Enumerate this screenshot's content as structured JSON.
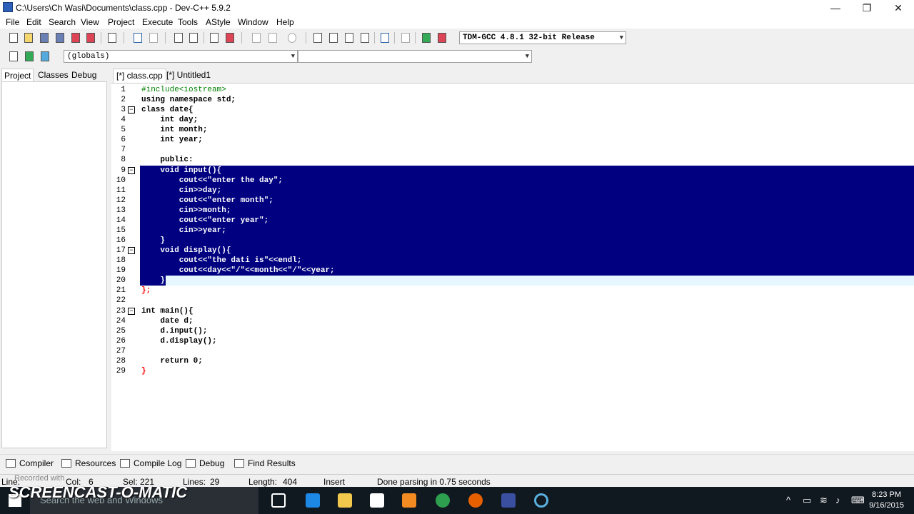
{
  "window": {
    "title": "C:\\Users\\Ch Wasi\\Documents\\class.cpp - Dev-C++ 5.9.2",
    "minimize": "—",
    "maximize": "❐",
    "close": "✕"
  },
  "menu": [
    "File",
    "Edit",
    "Search",
    "View",
    "Project",
    "Execute",
    "Tools",
    "AStyle",
    "Window",
    "Help"
  ],
  "toolbar": {
    "compiler_select": "TDM-GCC 4.8.1 32-bit Release",
    "scope_select": "(globals)",
    "member_select": ""
  },
  "left_panel": {
    "tabs": [
      "Project",
      "Classes",
      "Debug"
    ]
  },
  "file_tabs": [
    "[*] class.cpp",
    "[*] Untitled1"
  ],
  "editor": {
    "lines": [
      {
        "n": "1",
        "text": "#include<iostream>"
      },
      {
        "n": "2",
        "text": "using namespace std;"
      },
      {
        "n": "3",
        "text": "class date{"
      },
      {
        "n": "4",
        "text": "    int day;"
      },
      {
        "n": "5",
        "text": "    int month;"
      },
      {
        "n": "6",
        "text": "    int year;"
      },
      {
        "n": "7",
        "text": ""
      },
      {
        "n": "8",
        "text": "    public:"
      },
      {
        "n": "9",
        "text": "    void input(){"
      },
      {
        "n": "10",
        "text": "        cout<<\"enter the day\";"
      },
      {
        "n": "11",
        "text": "        cin>>day;"
      },
      {
        "n": "12",
        "text": "        cout<<\"enter month\";"
      },
      {
        "n": "13",
        "text": "        cin>>month;"
      },
      {
        "n": "14",
        "text": "        cout<<\"enter year\";"
      },
      {
        "n": "15",
        "text": "        cin>>year;"
      },
      {
        "n": "16",
        "text": "    }"
      },
      {
        "n": "17",
        "text": "    void display(){"
      },
      {
        "n": "18",
        "text": "        cout<<\"the dati is\"<<endl;"
      },
      {
        "n": "19",
        "text": "        cout<<day<<\"/\"<<month<<\"/\"<<year;"
      },
      {
        "n": "20",
        "text": "    }"
      },
      {
        "n": "21",
        "text": "};"
      },
      {
        "n": "22",
        "text": ""
      },
      {
        "n": "23",
        "text": "int main(){"
      },
      {
        "n": "24",
        "text": "    date d;"
      },
      {
        "n": "25",
        "text": "    d.input();"
      },
      {
        "n": "26",
        "text": "    d.display();"
      },
      {
        "n": "27",
        "text": ""
      },
      {
        "n": "28",
        "text": "    return 0;"
      },
      {
        "n": "29",
        "text": "}"
      }
    ]
  },
  "bottom_tabs": [
    "Compiler",
    "Resources",
    "Compile Log",
    "Debug",
    "Find Results"
  ],
  "status": {
    "line_label": "Line:",
    "col_label": "Col:",
    "col_value": "6",
    "sel_label": "Sel:",
    "sel_value": "221",
    "lines_label": "Lines:",
    "lines_value": "29",
    "length_label": "Length:",
    "length_value": "404",
    "mode": "Insert",
    "message": "Done parsing in 0.75 seconds"
  },
  "taskbar": {
    "search_placeholder": "Search the web and Windows",
    "time": "8:23 PM",
    "date": "9/16/2015"
  },
  "watermark": {
    "recorded": "Recorded with",
    "brand": "SCREENCAST-O-MATIC"
  },
  "colors": {
    "selection": "#000080",
    "keyword_text": "#000000",
    "brace": "#ff0000",
    "preprocessor": "#008000"
  }
}
